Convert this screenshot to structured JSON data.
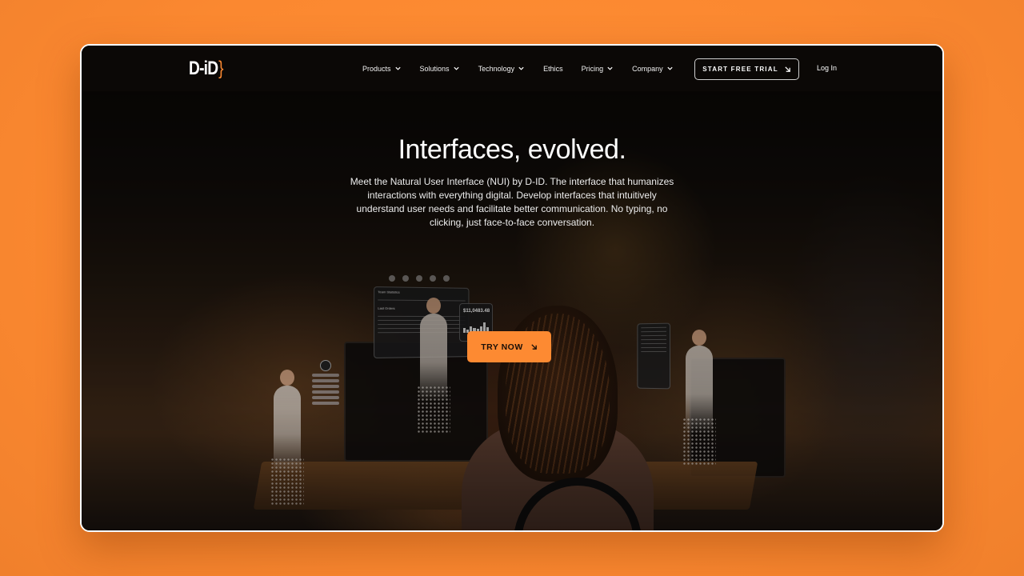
{
  "brand": {
    "logo_text": "D-iD",
    "logo_mark": "}",
    "accent_color": "#fd8a32",
    "page_background": "#fd8a32"
  },
  "nav": {
    "items": [
      {
        "label": "Products",
        "has_dropdown": true
      },
      {
        "label": "Solutions",
        "has_dropdown": true
      },
      {
        "label": "Technology",
        "has_dropdown": true
      },
      {
        "label": "Ethics",
        "has_dropdown": false
      },
      {
        "label": "Pricing",
        "has_dropdown": true
      },
      {
        "label": "Company",
        "has_dropdown": true
      }
    ],
    "cta_label": "START FREE TRIAL",
    "cta_icon": "arrow-down-right-icon",
    "login_label": "Log In"
  },
  "hero": {
    "title": "Interfaces, evolved.",
    "description": "Meet the Natural User Interface (NUI) by D-ID. The interface that humanizes interactions with everything digital. Develop interfaces that intuitively understand user needs and facilitate  better communication. No typing, no clicking, just face-to-face conversation.",
    "cta_label": "TRY NOW",
    "cta_icon": "arrow-down-right-icon"
  },
  "illustration": {
    "panels": {
      "stats_title": "Team Statistics",
      "orders_title": "Last Orders",
      "revenue_value": "$11,0483.48"
    }
  }
}
